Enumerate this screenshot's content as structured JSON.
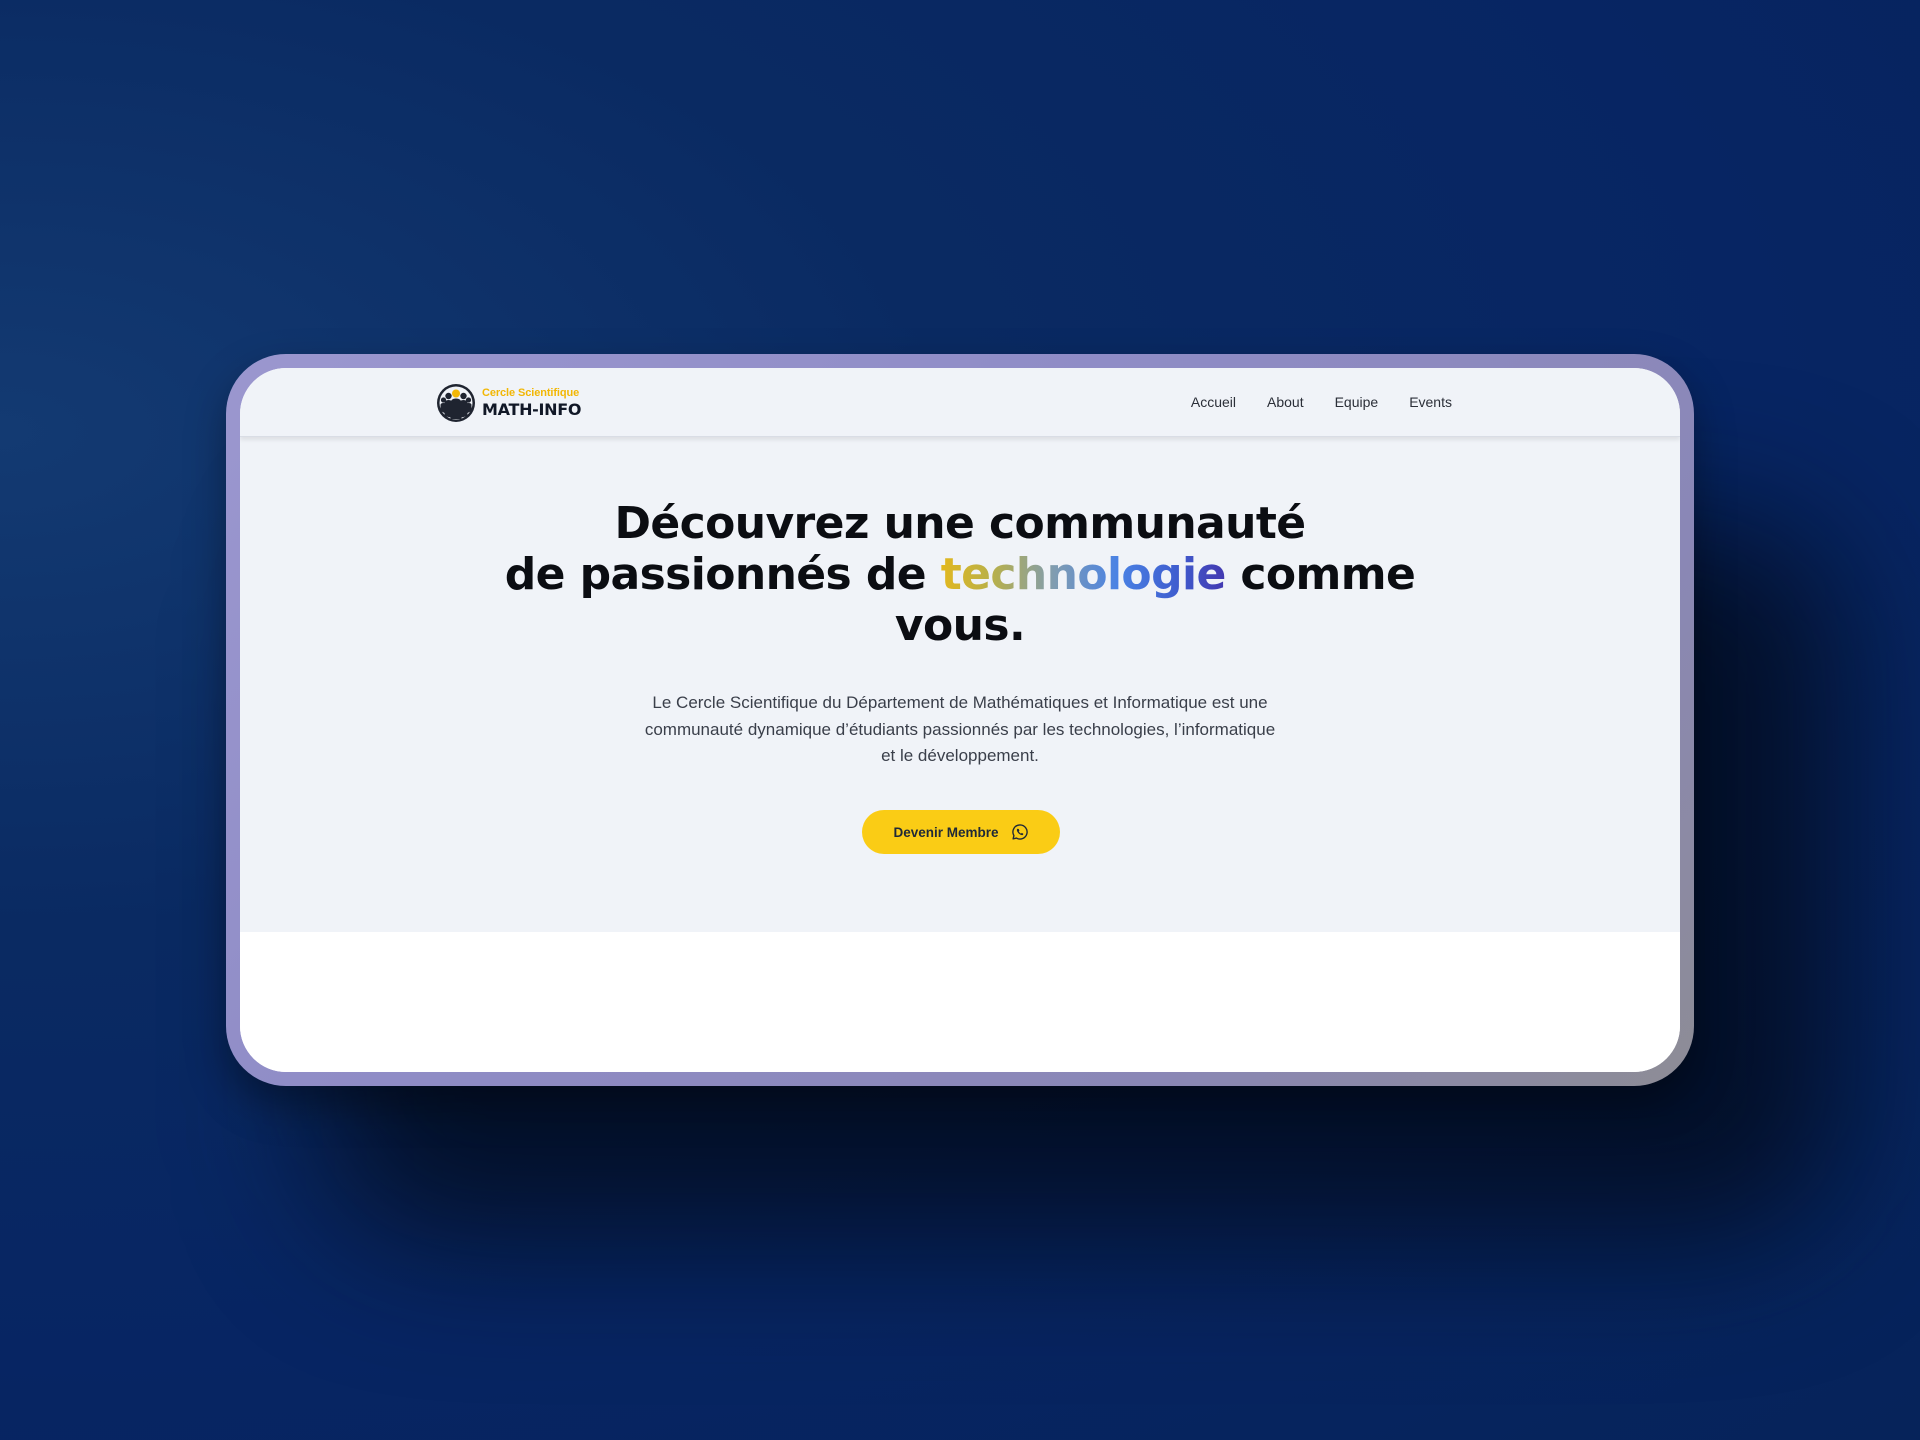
{
  "brand": {
    "top_line": "Cercle Scientifique",
    "name": "MATH-INFO",
    "logo_icon": "group-of-people-icon",
    "accent_color": "#f2b705"
  },
  "nav": {
    "items": [
      {
        "label": "Accueil"
      },
      {
        "label": "About"
      },
      {
        "label": "Equipe"
      },
      {
        "label": "Events"
      }
    ]
  },
  "hero": {
    "title_line1": "Découvrez une communauté",
    "title_line2_before": "de passionnés de ",
    "title_highlight": "technologie",
    "title_line2_after": " comme",
    "title_line3": "vous.",
    "description": "Le Cercle Scientifique du Département de Mathématiques et Informatique est une communauté dynamique d’étudiants passionnés par les technologies, l’informatique et le développement.",
    "cta_label": "Devenir Membre",
    "cta_icon": "whatsapp-icon",
    "cta_color": "#facc15"
  },
  "colors": {
    "background": "#072563",
    "frame": "#8f8cc6",
    "hero_background": "#f0f3f8",
    "highlight_gradient": [
      "#e2b81f",
      "#7f9cb2",
      "#4a82e4",
      "#4338b0"
    ]
  }
}
